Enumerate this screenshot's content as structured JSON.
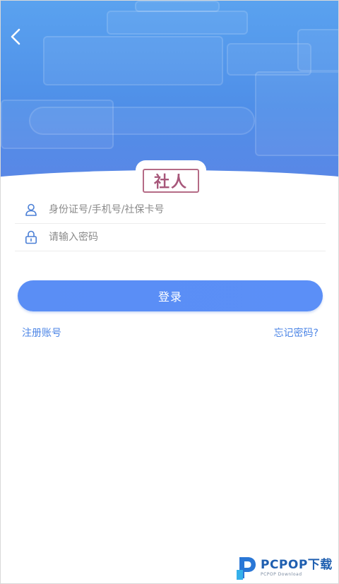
{
  "header": {
    "back_icon": "chevron-left-icon"
  },
  "logo": {
    "text": "社人"
  },
  "form": {
    "account": {
      "icon": "user-icon",
      "placeholder": "身份证号/手机号/社保卡号",
      "value": ""
    },
    "password": {
      "icon": "lock-icon",
      "placeholder": "请输入密码",
      "value": ""
    },
    "login_label": "登录",
    "register_label": "注册账号",
    "forgot_label": "忘记密码?"
  },
  "watermark": {
    "main": "PCPOP下载",
    "sub": "PCPOP Download"
  },
  "colors": {
    "banner": "#4f8fe8",
    "primary_button": "#5a8ef5",
    "link": "#4d86e6",
    "logo_seal": "#a7577a"
  }
}
